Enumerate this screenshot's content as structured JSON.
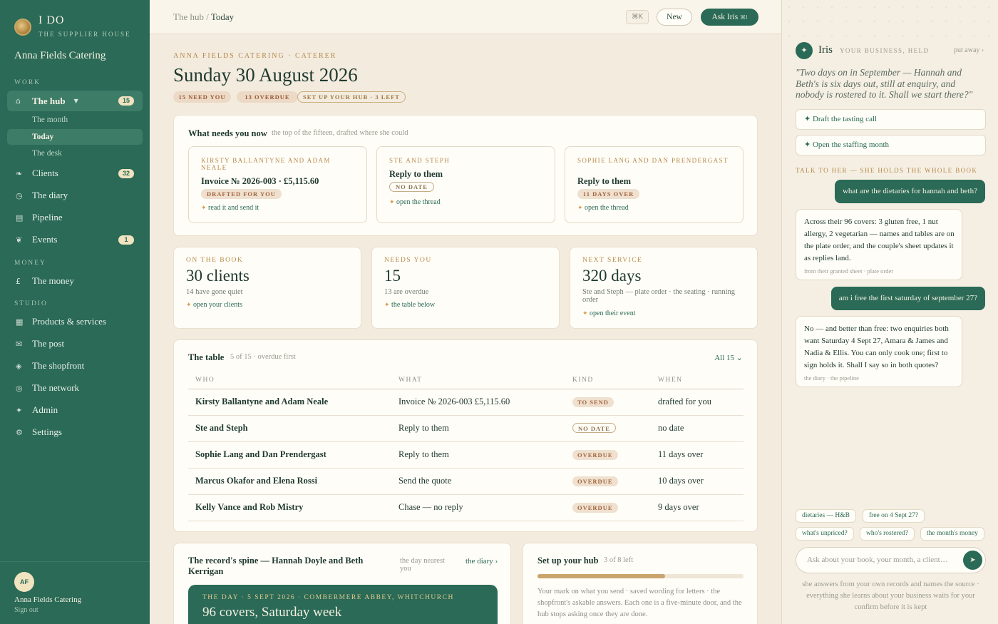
{
  "sidebar": {
    "brand_name": "I DO",
    "brand_sub": "THE SUPPLIER HOUSE",
    "business_name": "Anna Fields Catering",
    "sections": {
      "work": "WORK",
      "money": "MONEY",
      "studio": "STUDIO"
    },
    "hub": {
      "label": "The hub",
      "badge": "15",
      "icon": "house-icon"
    },
    "hub_sub": [
      {
        "label": "The month"
      },
      {
        "label": "Today"
      },
      {
        "label": "The desk"
      }
    ],
    "work_items": [
      {
        "label": "Clients",
        "badge": "32",
        "icon": "clients-icon"
      },
      {
        "label": "The diary",
        "icon": "clock-icon"
      },
      {
        "label": "Pipeline",
        "icon": "pipeline-icon"
      },
      {
        "label": "Events",
        "badge": "1",
        "icon": "events-icon"
      }
    ],
    "money_items": [
      {
        "label": "The money",
        "icon": "pound-icon"
      }
    ],
    "studio_items": [
      {
        "label": "Products & services",
        "icon": "grid-icon"
      },
      {
        "label": "The post",
        "icon": "mail-icon"
      },
      {
        "label": "The shopfront",
        "icon": "shopfront-icon"
      },
      {
        "label": "The network",
        "icon": "network-icon"
      },
      {
        "label": "Admin",
        "icon": "admin-icon"
      },
      {
        "label": "Settings",
        "icon": "gear-icon"
      }
    ],
    "footer": {
      "initials": "AF",
      "name": "Anna Fields Catering",
      "sign_out": "Sign out"
    }
  },
  "topbar": {
    "crumb_root": "The hub",
    "crumb_sep": " / ",
    "crumb_current": "Today",
    "shortcut": "⌘K",
    "new_label": "New",
    "ask_label": "Ask Iris",
    "ask_shortcut": "⌘I"
  },
  "header": {
    "eyebrow": "ANNA FIELDS CATERING · CATERER",
    "title": "Sunday 30 August 2026",
    "pills": [
      "15 NEED YOU",
      "13 OVERDUE",
      "SET UP YOUR HUB · 3 LEFT"
    ]
  },
  "needs": {
    "title": "What needs you now",
    "hint": "the top of the fifteen, drafted where she could",
    "items": [
      {
        "who": "KIRSTY BALLANTYNE AND ADAM NEALE",
        "what": "Invoice № 2026-003 · £5,115.60",
        "tag": "DRAFTED FOR YOU",
        "action": "read it and send it"
      },
      {
        "who": "STE AND STEPH",
        "what": "Reply to them",
        "tag": "NO DATE",
        "action": "open the thread"
      },
      {
        "who": "SOPHIE LANG AND DAN PRENDERGAST",
        "what": "Reply to them",
        "tag": "11 DAYS OVER",
        "action": "open the thread"
      }
    ]
  },
  "stats": [
    {
      "label": "ON THE BOOK",
      "value": "30 clients",
      "note": "14 have gone quiet",
      "action": "open your clients"
    },
    {
      "label": "NEEDS YOU",
      "value": "15",
      "note": "13 are overdue",
      "action": "the table below"
    },
    {
      "label": "NEXT SERVICE",
      "value": "320 days",
      "note": "Ste and Steph — plate order · the seating · running order",
      "action": "open their event"
    }
  ],
  "table": {
    "title": "The table",
    "hint": "5 of 15 · overdue first",
    "all_label": "All 15 ⌄",
    "columns": [
      "WHO",
      "WHAT",
      "KIND",
      "WHEN"
    ],
    "rows": [
      {
        "who": "Kirsty Ballantyne and Adam Neale",
        "what": "Invoice № 2026-003 £5,115.60",
        "kind": "TO SEND",
        "when": "drafted for you"
      },
      {
        "who": "Ste and Steph",
        "what": "Reply to them",
        "kind": "NO DATE",
        "when": "no date"
      },
      {
        "who": "Sophie Lang and Dan Prendergast",
        "what": "Reply to them",
        "kind": "OVERDUE",
        "when": "11 days over"
      },
      {
        "who": "Marcus Okafor and Elena Rossi",
        "what": "Send the quote",
        "kind": "OVERDUE",
        "when": "10 days over"
      },
      {
        "who": "Kelly Vance and Rob Mistry",
        "what": "Chase — no reply",
        "kind": "OVERDUE",
        "when": "9 days over"
      }
    ]
  },
  "spine": {
    "title": "The record's spine — Hannah Doyle and Beth Kerrigan",
    "hint": "the day nearest you",
    "link": "the diary ›",
    "eyebrow": "THE DAY · 5 SEPT 2026 · COMBERMERE ABBEY, WHITCHURCH",
    "headline": "96 covers, Saturday week"
  },
  "setup": {
    "title": "Set up your hub",
    "count": "3 of 8 left",
    "progress": 0.62,
    "body": "Your mark on what you send · saved wording for letters · the shopfront's askable answers. Each one is a five-minute door, and the hub stops asking once they are done."
  },
  "iris": {
    "name": "Iris",
    "tagline": "YOUR BUSINESS, HELD",
    "put_away": "put away ›",
    "quote": "\"Two days on in September — Hannah and Beth's is six days out, still at enquiry, and nobody is rostered to it. Shall we start there?\"",
    "actions": [
      "✦ Draft the tasting call",
      "✦ Open the staffing month"
    ],
    "talk_label": "TALK TO HER — SHE HOLDS THE WHOLE BOOK",
    "messages": [
      {
        "from": "me",
        "text": "what are the dietaries for hannah and beth?"
      },
      {
        "from": "her",
        "text": "Across their 96 covers: 3 gluten free, 1 nut allergy, 2 vegetarian — names and tables are on the plate order, and the couple's sheet updates it as replies land.",
        "source": "from their granted sheet · plate order"
      },
      {
        "from": "me",
        "text": "am i free the first saturday of september 27?"
      },
      {
        "from": "her",
        "text": "No — and better than free: two enquiries both want Saturday 4 Sept 27, Amara & James and Nadia & Ellis. You can only cook one; first to sign holds it. Shall I say so in both quotes?",
        "source": "the diary · the pipeline"
      }
    ],
    "chips": [
      "dietaries — H&B",
      "free on 4 Sept 27?",
      "what's unpriced?",
      "who's rostered?",
      "the month's money"
    ],
    "input_placeholder": "Ask about your book, your month, a client…",
    "footer": "she answers from your own records and names the source · everything she learns about your business waits for your confirm before it is kept"
  }
}
